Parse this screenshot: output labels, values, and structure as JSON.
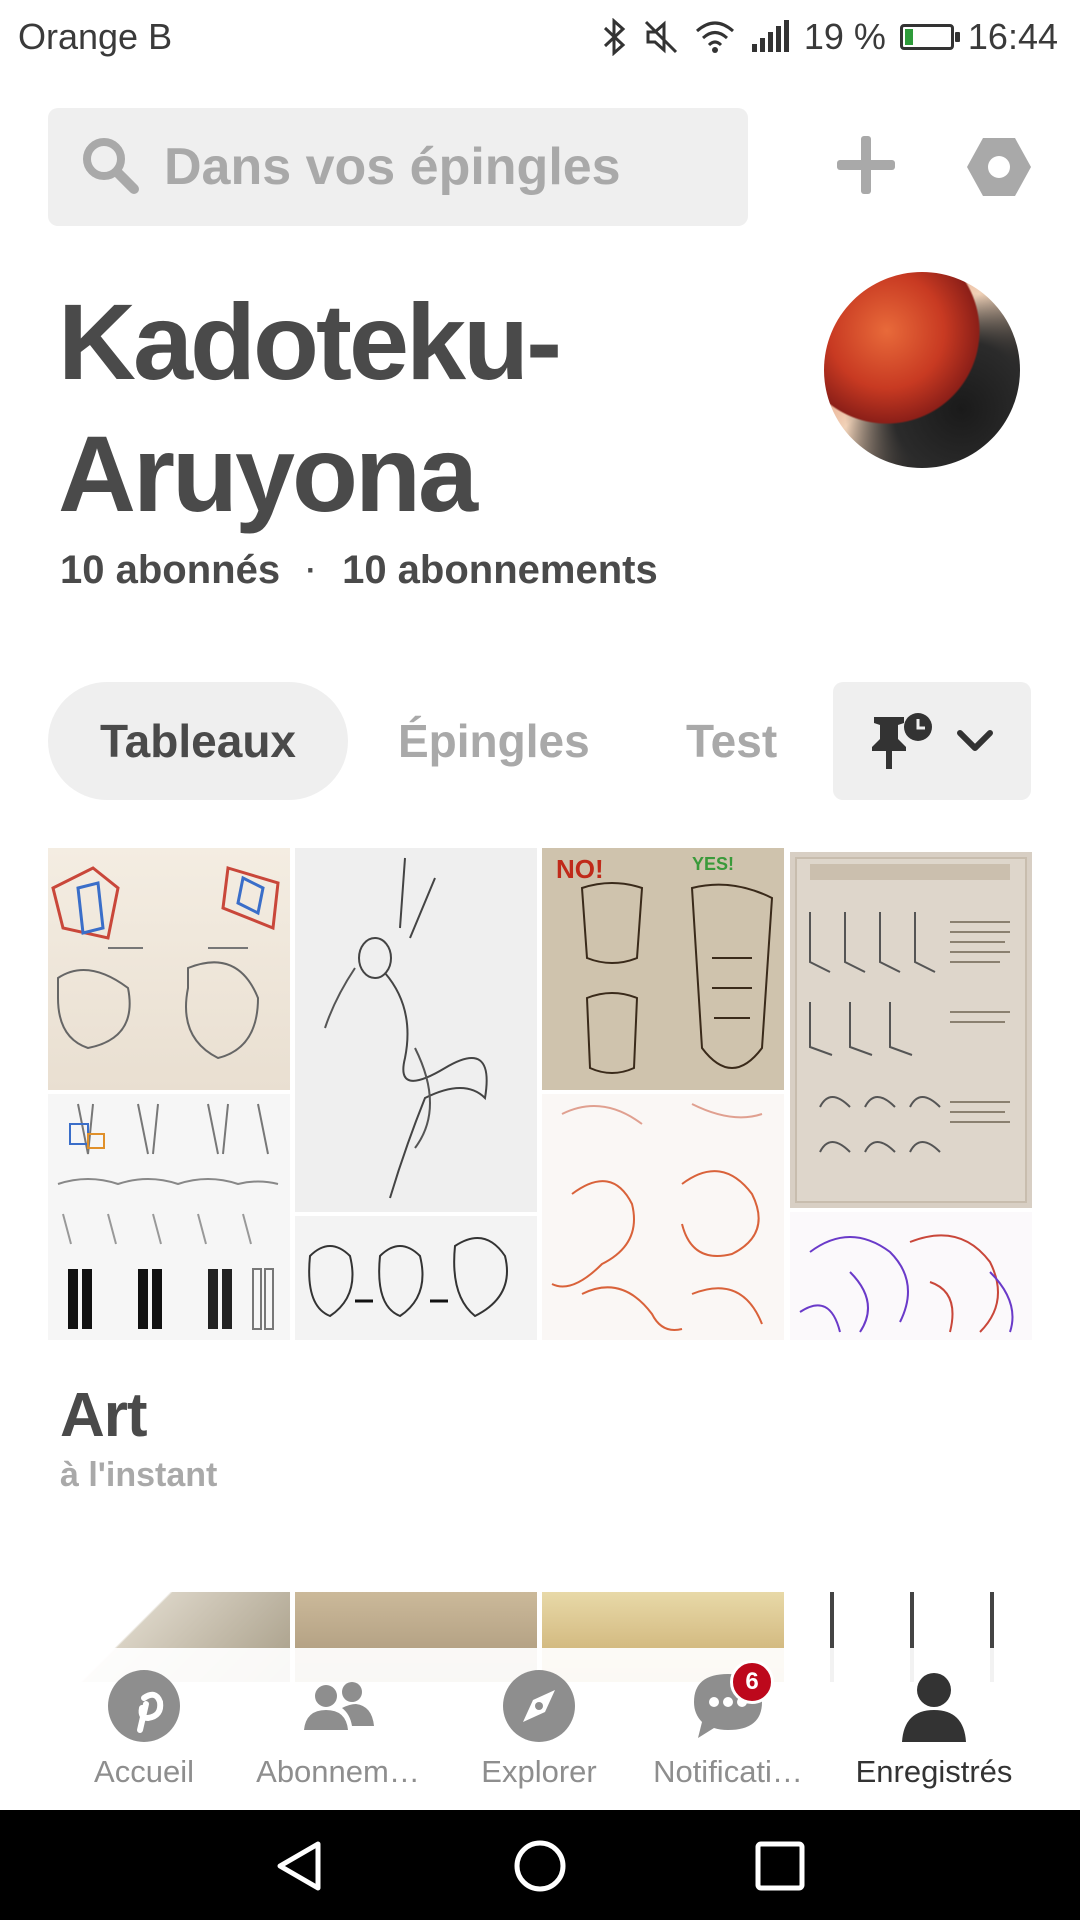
{
  "status_bar": {
    "carrier": "Orange B",
    "battery_text": "19 %",
    "battery_level": 0.19,
    "time": "16:44",
    "icons": [
      "bluetooth-icon",
      "mute-icon",
      "wifi-icon",
      "signal-icon",
      "battery-icon"
    ]
  },
  "search": {
    "placeholder": "Dans vos épingles",
    "icon": "search-icon"
  },
  "header_actions": {
    "add_icon": "plus-icon",
    "settings_icon": "hexagon-settings-icon"
  },
  "profile": {
    "name_line1": "Kadoteku-",
    "name_line2": "Aruyona",
    "followers": "10 abonnés",
    "separator": "·",
    "following": "10 abonnements"
  },
  "tabs": [
    {
      "label": "Tableaux",
      "active": true
    },
    {
      "label": "Épingles",
      "active": false
    },
    {
      "label": "Test",
      "active": false
    }
  ],
  "sort": {
    "icon": "pin-clock-icon",
    "chevron": "chevron-down-icon"
  },
  "boards": [
    {
      "title": "Art",
      "time": "à l'instant"
    }
  ],
  "bottom_nav": [
    {
      "label": "Accueil",
      "icon": "pinterest-icon",
      "active": false
    },
    {
      "label": "Abonnem…",
      "icon": "people-icon",
      "active": false
    },
    {
      "label": "Explorer",
      "icon": "compass-icon",
      "active": false
    },
    {
      "label": "Notificati…",
      "icon": "chat-bubble-icon",
      "active": false,
      "badge": "6"
    },
    {
      "label": "Enregistrés",
      "icon": "person-icon",
      "active": true
    }
  ],
  "colors": {
    "text_dark": "#4a4a4a",
    "text_muted": "#a9a9a9",
    "pill_bg": "#efefef",
    "badge_red": "#bd081c"
  }
}
